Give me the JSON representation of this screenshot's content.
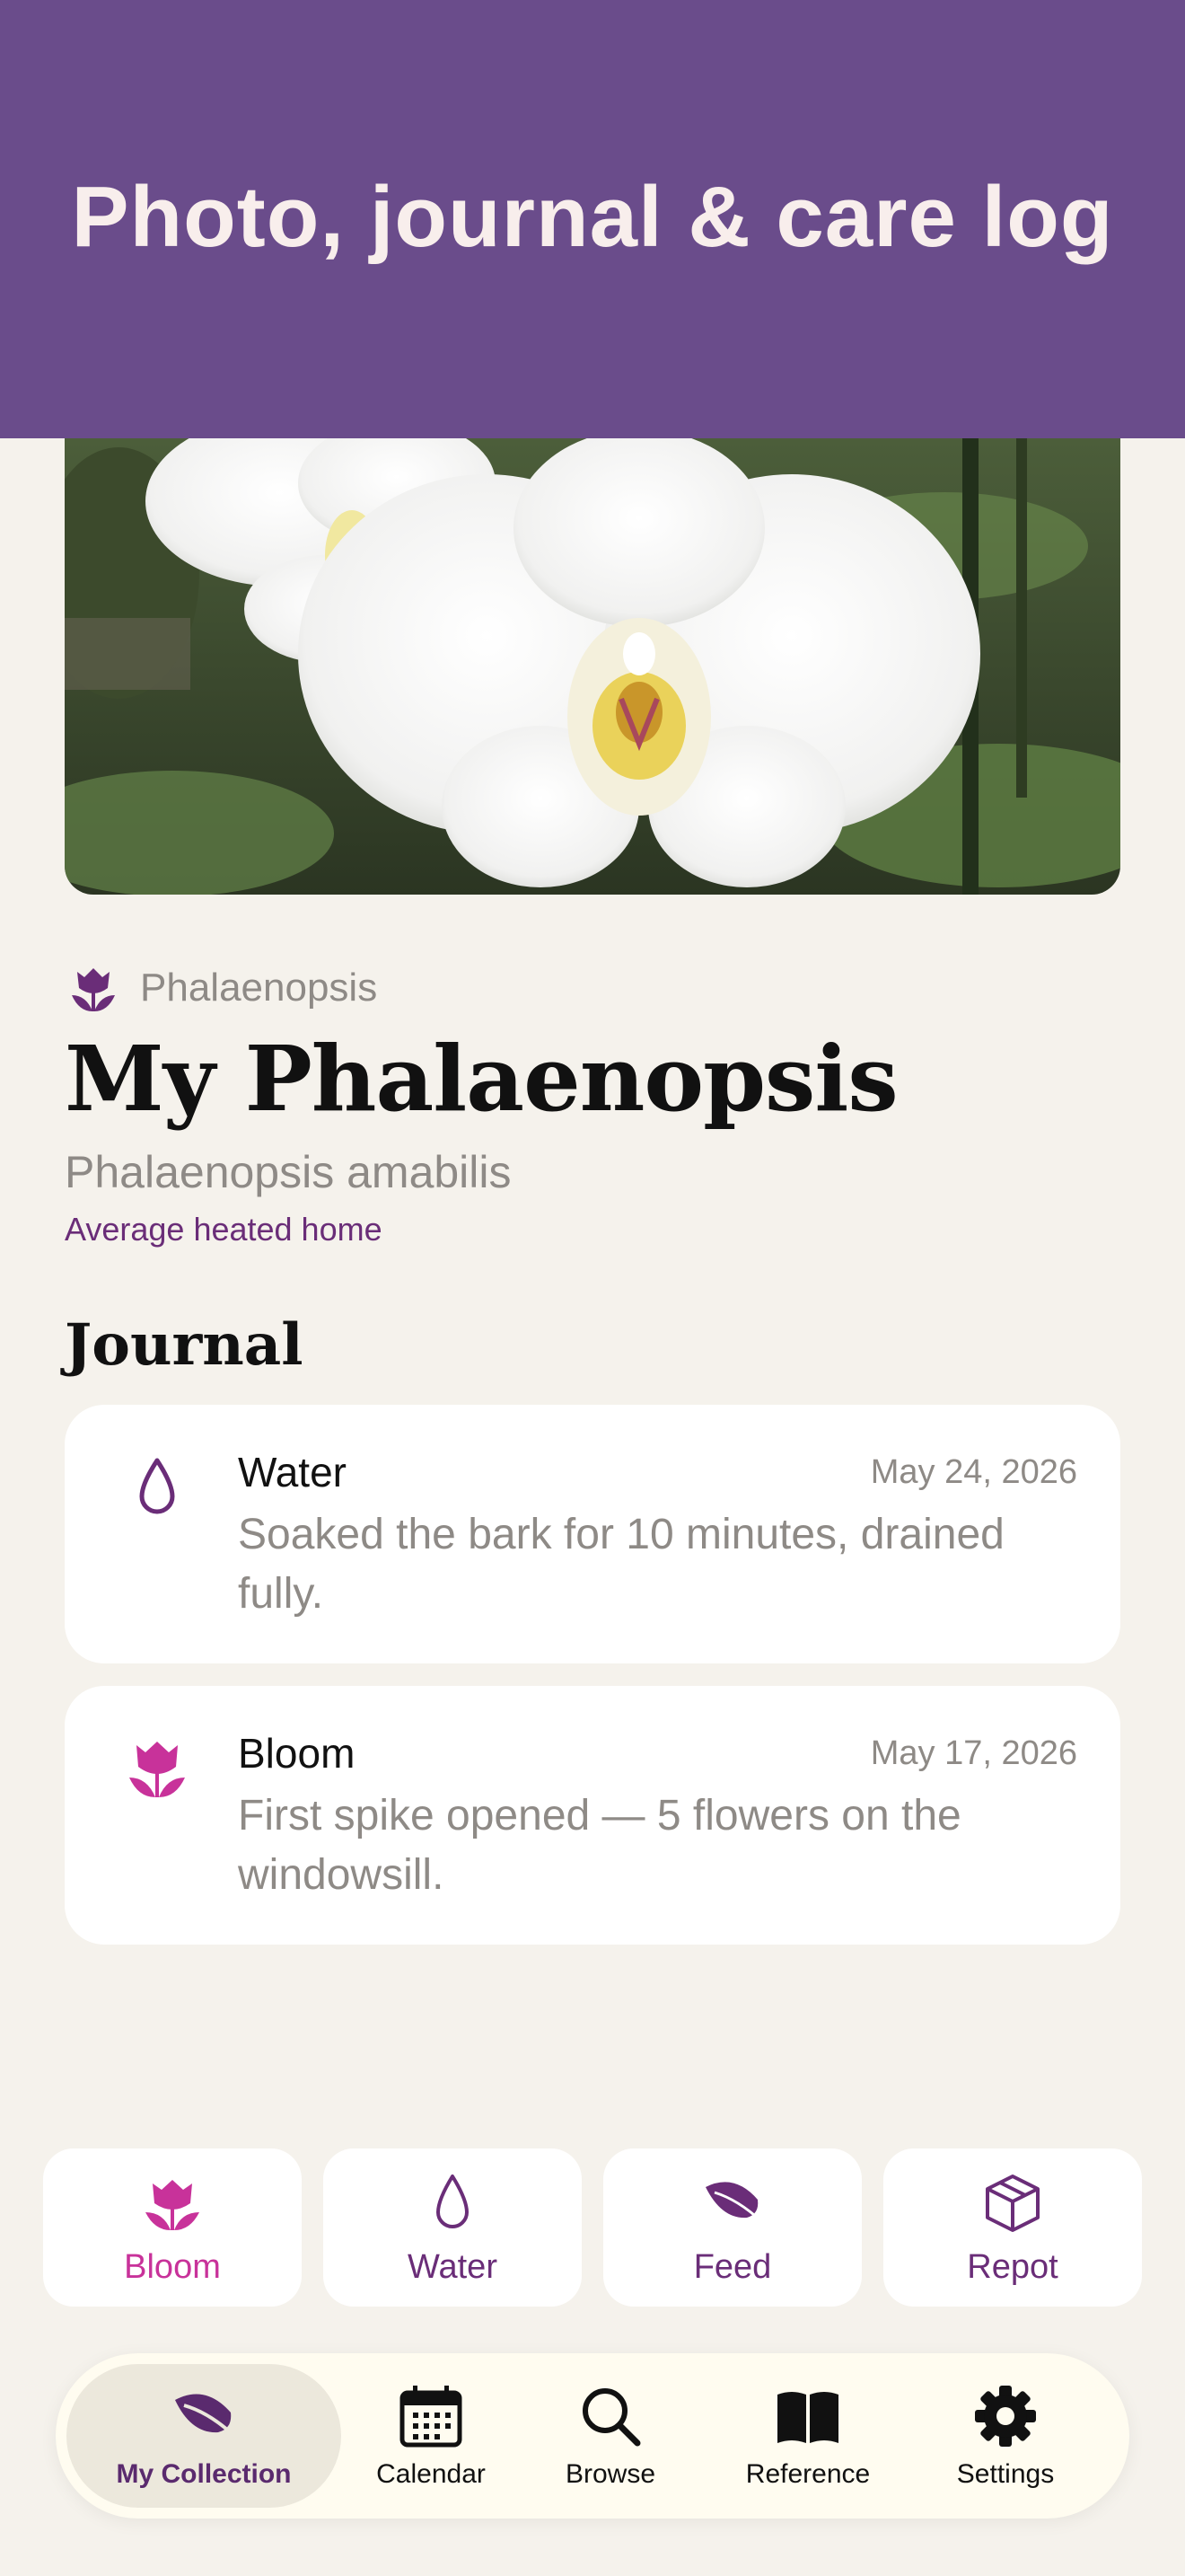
{
  "header": {
    "title": "Photo, journal & care log"
  },
  "plant": {
    "genus": "Phalaenopsis",
    "name": "My Phalaenopsis",
    "species": "Phalaenopsis amabilis",
    "environment": "Average heated home"
  },
  "journal": {
    "section_title": "Journal",
    "entries": [
      {
        "icon": "water-drop-icon",
        "type": "Water",
        "date": "May 24, 2026",
        "note": "Soaked the bark for 10 minutes, drained fully."
      },
      {
        "icon": "tulip-icon",
        "type": "Bloom",
        "date": "May 17, 2026",
        "note": "First spike opened — 5 flowers on the windowsill."
      }
    ]
  },
  "quick_actions": [
    {
      "label": "Bloom",
      "icon": "tulip-icon",
      "color": "#C8329A"
    },
    {
      "label": "Water",
      "icon": "water-drop-icon",
      "color": "#6A2D78"
    },
    {
      "label": "Feed",
      "icon": "leaf-icon",
      "color": "#6A2D78"
    },
    {
      "label": "Repot",
      "icon": "box-icon",
      "color": "#6A2D78"
    }
  ],
  "tab_bar": {
    "active": "My Collection",
    "tabs": [
      {
        "label": "My Collection",
        "icon": "leaf-icon"
      },
      {
        "label": "Calendar",
        "icon": "calendar-icon"
      },
      {
        "label": "Browse",
        "icon": "search-icon"
      },
      {
        "label": "Reference",
        "icon": "book-icon"
      },
      {
        "label": "Settings",
        "icon": "gear-icon"
      }
    ]
  },
  "colors": {
    "header_bg": "#6A4C8B",
    "accent_purple": "#6A2D78",
    "accent_magenta": "#C8329A",
    "background": "#F5F2EC"
  }
}
